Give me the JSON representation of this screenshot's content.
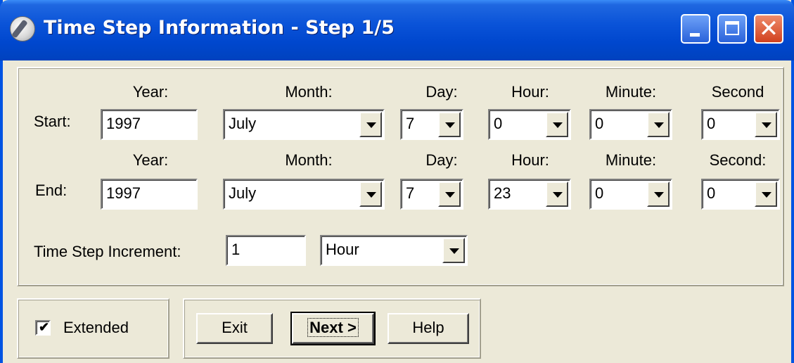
{
  "window": {
    "title": "Time Step Information - Step 1/5"
  },
  "headers": {
    "start": [
      "Year:",
      "Month:",
      "Day:",
      "Hour:",
      "Minute:",
      "Second"
    ],
    "end": [
      "Year:",
      "Month:",
      "Day:",
      "Hour:",
      "Minute:",
      "Second:"
    ]
  },
  "start": {
    "label": "Start:",
    "year": "1997",
    "month": "July",
    "day": "7",
    "hour": "0",
    "minute": "0",
    "second": "0"
  },
  "end": {
    "label": "End:",
    "year": "1997",
    "month": "July",
    "day": "7",
    "hour": "23",
    "minute": "0",
    "second": "0"
  },
  "increment": {
    "label": "Time Step Increment:",
    "value": "1",
    "unit": "Hour"
  },
  "extended": {
    "label": "Extended",
    "checked": true
  },
  "buttons": {
    "exit": "Exit",
    "next": "Next >",
    "help": "Help"
  },
  "colors": {
    "titlebar": "#0054E3",
    "face": "#ECE9D8",
    "close": "#D1411E"
  }
}
